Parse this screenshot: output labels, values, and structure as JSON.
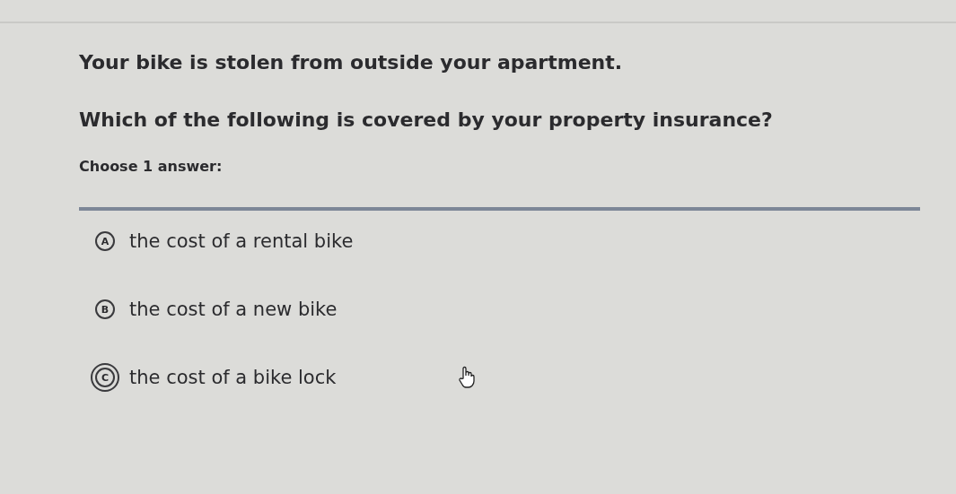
{
  "question": {
    "scenario": "Your bike is stolen from outside your apartment.",
    "prompt": "Which of the following is covered by your property insurance?"
  },
  "instruction": "Choose 1 answer:",
  "choices": [
    {
      "letter": "A",
      "text": "the cost of a rental bike",
      "hovered": false
    },
    {
      "letter": "B",
      "text": "the cost of a new bike",
      "hovered": false
    },
    {
      "letter": "C",
      "text": "the cost of a bike lock",
      "hovered": true
    }
  ]
}
